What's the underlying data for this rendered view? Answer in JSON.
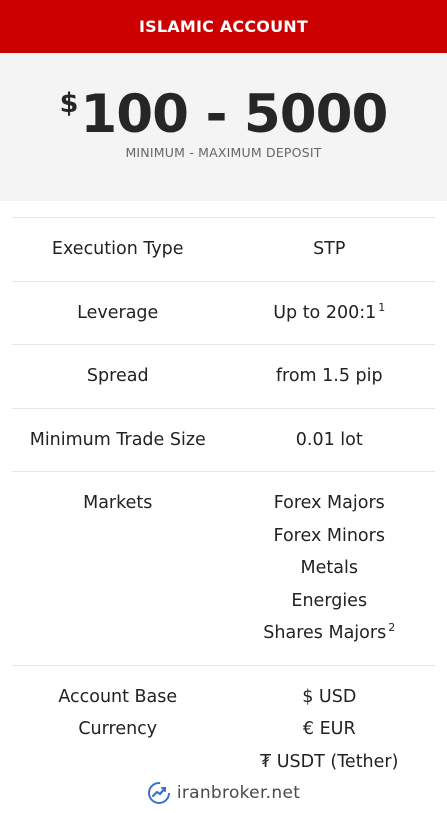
{
  "header": {
    "title": "ISLAMIC ACCOUNT"
  },
  "deposit": {
    "currency_symbol": "$",
    "range": "100 - 5000",
    "caption": "MINIMUM - MAXIMUM DEPOSIT"
  },
  "rows": [
    {
      "label": "Execution Type",
      "value": "STP"
    },
    {
      "label": "Leverage",
      "value": "Up to 200:1",
      "note": "1"
    },
    {
      "label": "Spread",
      "value": "from 1.5 pip"
    },
    {
      "label": "Minimum Trade Size",
      "value": "0.01 lot"
    },
    {
      "label": "Markets",
      "values": [
        "Forex Majors",
        "Forex Minors",
        "Metals",
        "Energies",
        "Shares Majors"
      ],
      "note": "2"
    },
    {
      "label_lines": [
        "Account Base",
        "Currency"
      ],
      "values": [
        "$ USD",
        "€ EUR",
        "₮ USDT (Tether)"
      ]
    }
  ],
  "watermark": {
    "text": "iranbroker.net",
    "icon": "chart-trend-logo-icon",
    "color": "#3b6fd8"
  }
}
